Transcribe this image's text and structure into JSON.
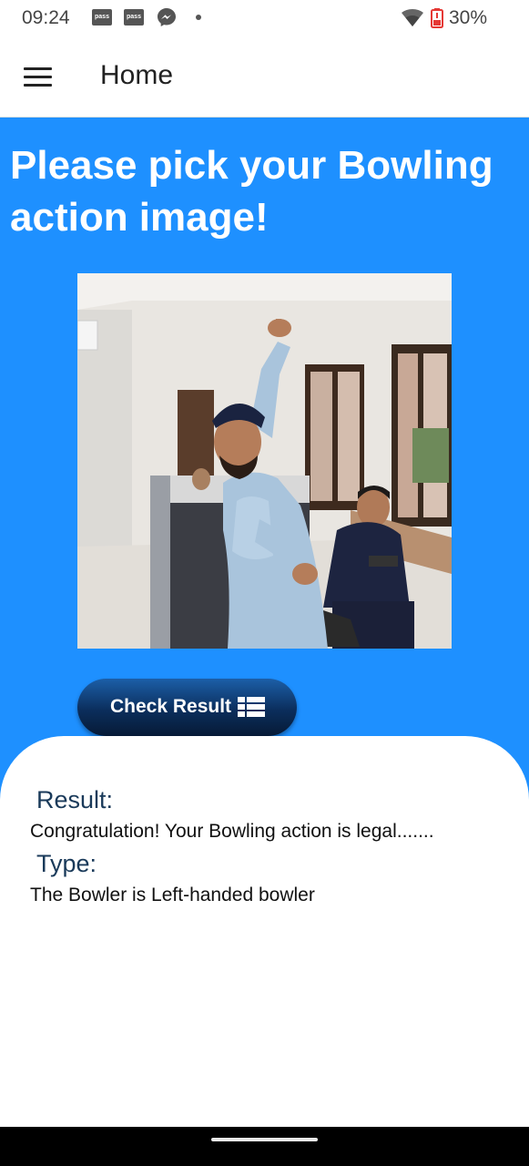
{
  "status_bar": {
    "time": "09:24",
    "notification_icons": [
      "pass-icon",
      "pass-icon",
      "messenger-icon",
      "dot-icon"
    ],
    "pass_label": "pass",
    "battery_percent": "30%"
  },
  "app_bar": {
    "title": "Home"
  },
  "main": {
    "heading": "Please pick your Bowling action image!",
    "button_label": "Check Result",
    "background_color": "#1e90ff"
  },
  "result": {
    "result_label": "Result:",
    "result_text": "Congratulation! Your Bowling action is legal.......",
    "type_label": "Type:",
    "type_text": "The Bowler is Left-handed bowler"
  }
}
